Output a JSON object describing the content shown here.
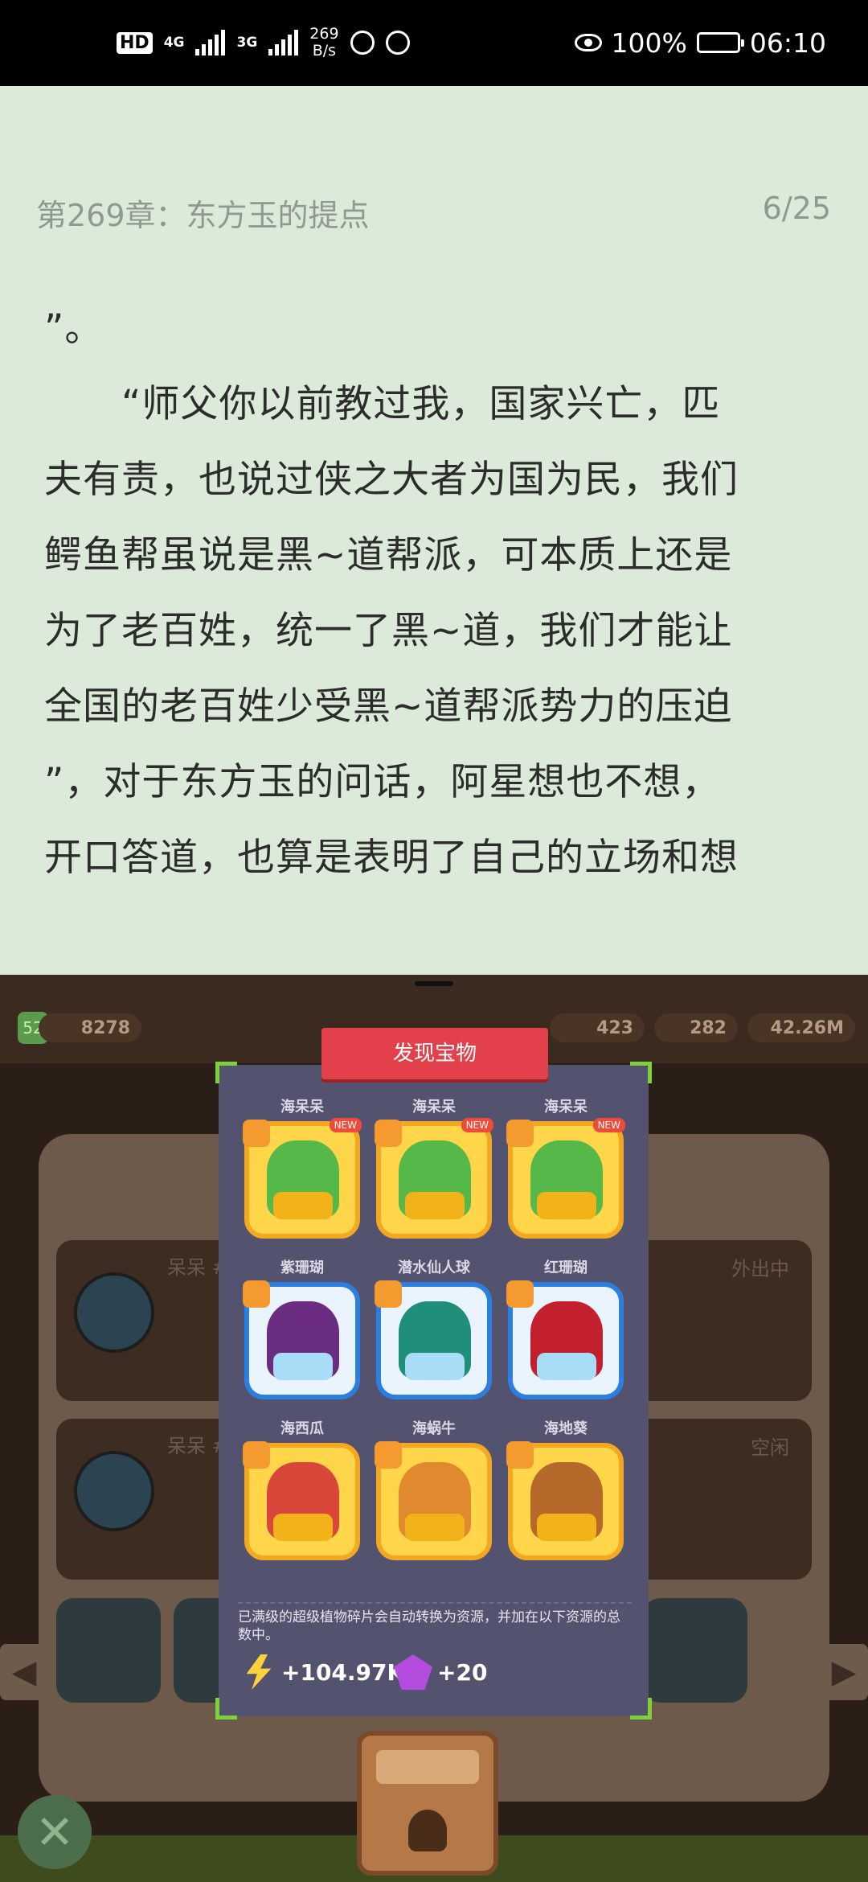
{
  "status_bar": {
    "hd": "HD",
    "net1": "4G",
    "net2": "3G",
    "speed_value": "269",
    "speed_unit": "B/s",
    "battery_percent": "100%",
    "time": "06:10"
  },
  "reader": {
    "chapter_title": "第269章：东方玉的提点",
    "page": "6/25",
    "lines": [
      "”。",
      "　　“师父你以前教过我，国家兴亡，匹",
      "夫有责，也说过侠之大者为国为民，我们",
      "鳄鱼帮虽说是黑~道帮派，可本质上还是",
      "为了老百姓，统一了黑~道，我们才能让",
      "全国的老百姓少受黑~道帮派势力的压迫",
      "”，对于东方玉的问话，阿星想也不想，",
      "开口答道，也算是表明了自己的立场和想"
    ]
  },
  "game": {
    "level": "52",
    "coins": "8278",
    "res_gem": "423",
    "res_ruby": "282",
    "res_energy": "42.26M",
    "bg_card1_name": "呆呆 #1",
    "bg_card1_state": "外出中",
    "bg_card2_name": "呆呆 #2",
    "bg_card2_state": "空闲",
    "modal": {
      "title": "发现宝物",
      "new_badge": "NEW",
      "items": [
        {
          "label": "海呆呆",
          "style": "gold",
          "plant": "#56b848",
          "base": "#f2b21a",
          "new": true
        },
        {
          "label": "海呆呆",
          "style": "gold",
          "plant": "#56b848",
          "base": "#f2b21a",
          "new": true
        },
        {
          "label": "海呆呆",
          "style": "gold",
          "plant": "#56b848",
          "base": "#f2b21a",
          "new": true
        },
        {
          "label": "紫珊瑚",
          "style": "blue",
          "plant": "#6a2d82",
          "base": "#a9dcf6",
          "new": false
        },
        {
          "label": "潜水仙人球",
          "style": "blue",
          "plant": "#1f8f7a",
          "base": "#a9dcf6",
          "new": false
        },
        {
          "label": "红珊瑚",
          "style": "blue",
          "plant": "#c2202c",
          "base": "#a9dcf6",
          "new": false
        },
        {
          "label": "海西瓜",
          "style": "gold",
          "plant": "#d9473a",
          "base": "#f2b21a",
          "new": false
        },
        {
          "label": "海蜗牛",
          "style": "gold",
          "plant": "#e0892e",
          "base": "#f2b21a",
          "new": false
        },
        {
          "label": "海地葵",
          "style": "gold",
          "plant": "#b56a2c",
          "base": "#f2b21a",
          "new": false
        }
      ],
      "note": "已满级的超级植物碎片会自动转换为资源，并加在以下资源的总数中。",
      "reward_energy": "+104.97K",
      "reward_gem": "+20"
    }
  }
}
